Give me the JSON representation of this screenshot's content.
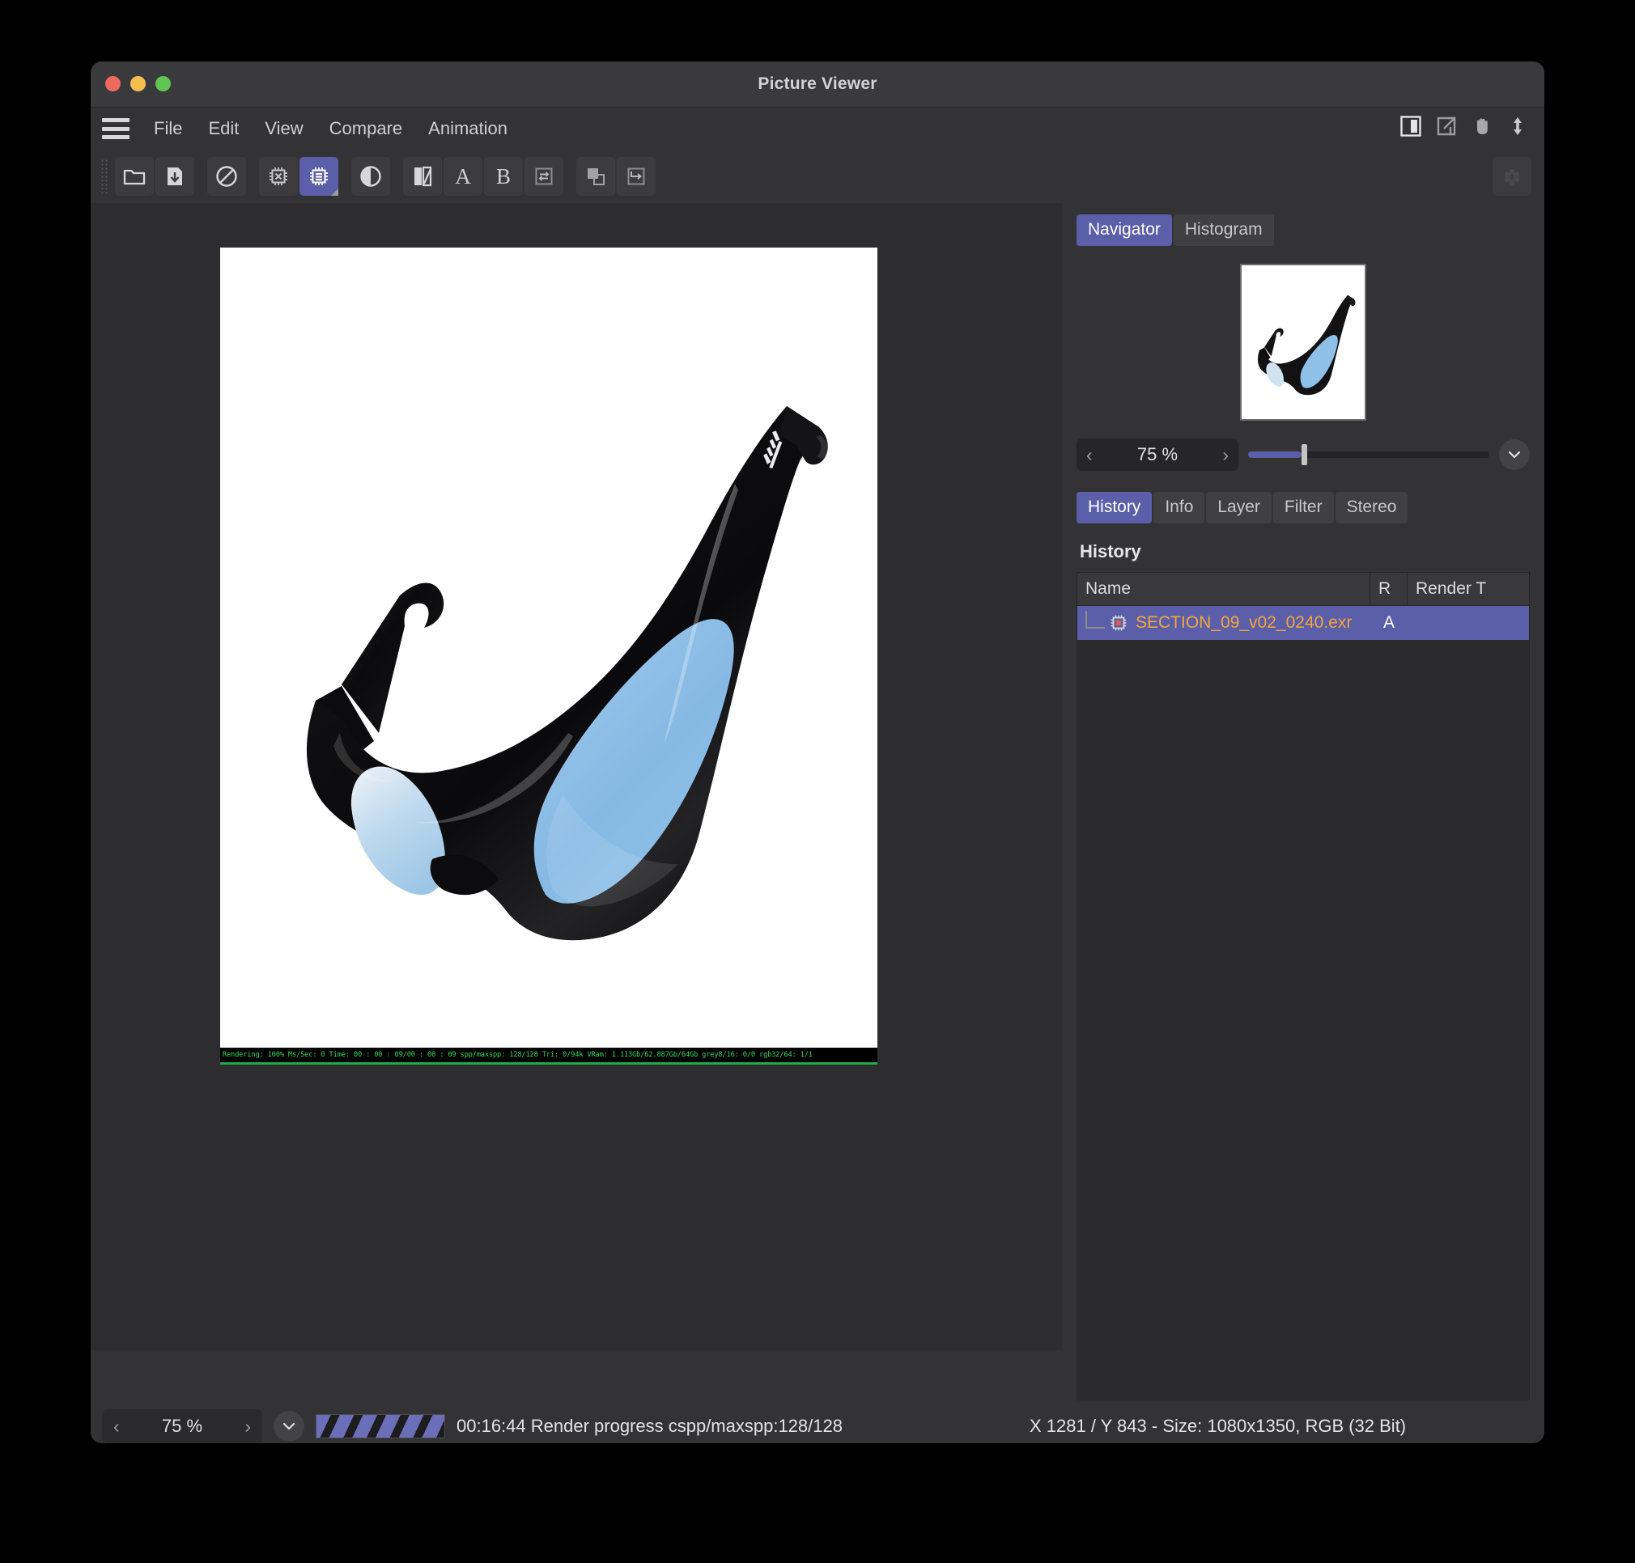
{
  "window": {
    "title": "Picture Viewer",
    "traffic_lights": [
      "close",
      "minimize",
      "maximize"
    ]
  },
  "menubar": {
    "items": [
      {
        "label": "File"
      },
      {
        "label": "Edit"
      },
      {
        "label": "View"
      },
      {
        "label": "Compare"
      },
      {
        "label": "Animation"
      }
    ],
    "right_icons": [
      {
        "name": "split-view-icon"
      },
      {
        "name": "open-external-icon"
      },
      {
        "name": "pan-hand-icon"
      },
      {
        "name": "vertical-resize-icon"
      }
    ]
  },
  "toolbar": {
    "groups": [
      {
        "buttons": [
          {
            "name": "open-folder-icon",
            "label": "Open",
            "active": false
          },
          {
            "name": "save-download-icon",
            "label": "Save",
            "active": false
          }
        ]
      },
      {
        "buttons": [
          {
            "name": "no-entry-icon",
            "label": "Stop Render",
            "active": false
          }
        ]
      },
      {
        "buttons": [
          {
            "name": "cpu-stop-icon",
            "label": "Abort Render",
            "active": false
          },
          {
            "name": "cpu-render-icon",
            "label": "Render",
            "active": true
          }
        ]
      },
      {
        "buttons": [
          {
            "name": "contrast-icon",
            "label": "Contrast",
            "active": false
          }
        ]
      },
      {
        "buttons": [
          {
            "name": "compare-split-icon",
            "label": "Compare",
            "active": false
          },
          {
            "name": "slot-a-letter",
            "label": "A",
            "active": false
          },
          {
            "name": "slot-b-letter",
            "label": "B",
            "active": false
          },
          {
            "name": "swap-ab-icon",
            "label": "Swap A/B",
            "active": false
          }
        ]
      },
      {
        "buttons": [
          {
            "name": "layers-icon",
            "label": "Layers",
            "active": false
          },
          {
            "name": "send-to-icon",
            "label": "Send To",
            "active": false
          }
        ]
      }
    ],
    "right_button": {
      "name": "render-settings-icon",
      "label": "Render Settings"
    }
  },
  "navigator": {
    "tabs": [
      {
        "label": "Navigator",
        "active": true
      },
      {
        "label": "Histogram",
        "active": false
      }
    ],
    "zoom": {
      "value": "75 %",
      "prev_label": "‹",
      "next_label": "›",
      "slider_percent": 22,
      "dropdown_icon": "chevron-down-icon"
    }
  },
  "inspector": {
    "tabs": [
      {
        "label": "History",
        "active": true
      },
      {
        "label": "Info",
        "active": false
      },
      {
        "label": "Layer",
        "active": false
      },
      {
        "label": "Filter",
        "active": false
      },
      {
        "label": "Stereo",
        "active": false
      }
    ],
    "panel_title": "History",
    "table": {
      "columns": [
        "Name",
        "R",
        "Render T"
      ],
      "rows": [
        {
          "icon": "cpu-render-chip-icon",
          "name": "SECTION_09_v02_0240.exr",
          "r": "A",
          "render_t": ""
        }
      ]
    }
  },
  "canvas": {
    "render_overlay": "Rendering: 100%   Ms/Sec: 0   Time: 00 : 00 : 09/00 : 00 : 09   spp/maxspp: 128/128   Tri: 0/94k   VRam: 1.113Gb/62.887Gb/64Gb   grey8/16: 0/0   rgb32/64: 1/1"
  },
  "statusbar": {
    "zoom": {
      "value": "75 %",
      "prev_label": "‹",
      "next_label": "›",
      "dropdown_icon": "chevron-down-icon"
    },
    "progress_label": "00:16:44 Render progress  cspp/maxspp:128/128",
    "coords": "X 1281 / Y 843 - Size: 1080x1350, RGB (32 Bit)"
  },
  "colors": {
    "accent": "#5b5ea8",
    "window_bg": "#333335",
    "canvas_bg": "#2d2d2f",
    "filename_orange": "#f2a63c",
    "overlay_green": "#35d95f",
    "lens_blue": "#8fc0e8"
  }
}
